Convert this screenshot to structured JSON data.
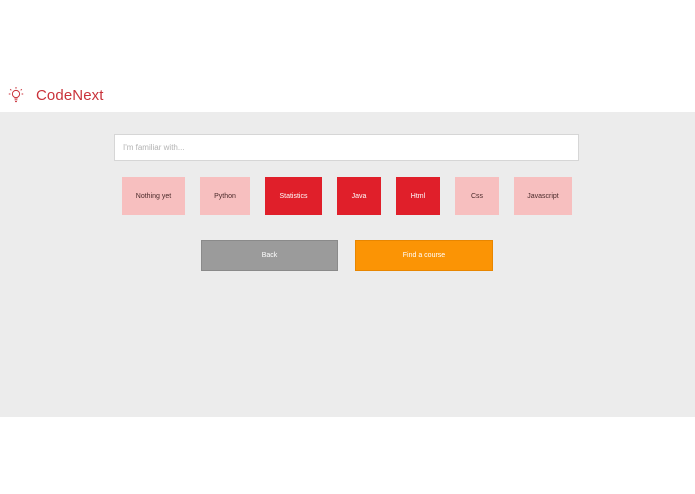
{
  "brand": {
    "name": "CodeNext",
    "icon": "lightbulb-icon",
    "color": "#c9323a"
  },
  "search": {
    "placeholder": "I'm familiar with...",
    "value": ""
  },
  "skills": [
    {
      "label": "Nothing yet",
      "selected": false
    },
    {
      "label": "Python",
      "selected": false
    },
    {
      "label": "Statistics",
      "selected": true
    },
    {
      "label": "Java",
      "selected": true
    },
    {
      "label": "Html",
      "selected": true
    },
    {
      "label": "Css",
      "selected": false
    },
    {
      "label": "Javascript",
      "selected": false
    }
  ],
  "actions": {
    "back_label": "Back",
    "find_label": "Find a course"
  },
  "colors": {
    "panel_bg": "#ececec",
    "chip_selected": "#e01f2a",
    "chip_unselected": "#f7bfbf",
    "back_button": "#9b9b9b",
    "find_button": "#fb9405"
  }
}
